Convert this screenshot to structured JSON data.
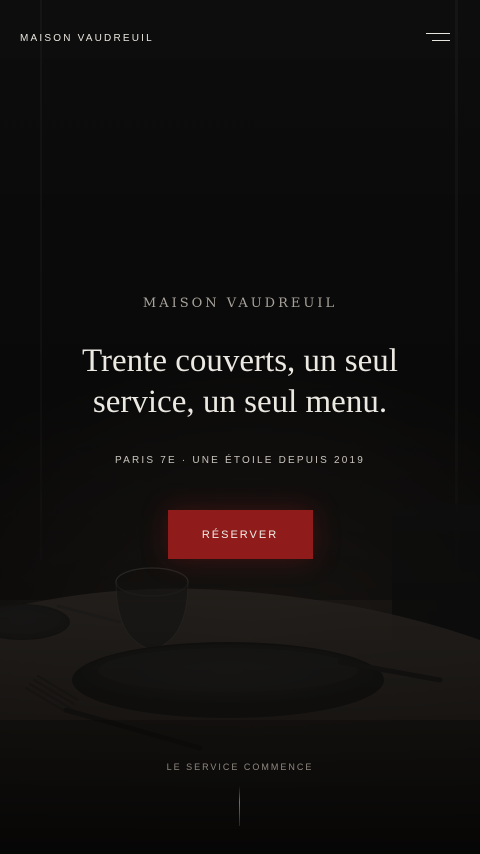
{
  "header": {
    "brand": "MAISON VAUDREUIL",
    "menu_icon": "hamburger-menu-icon"
  },
  "hero": {
    "eyebrow": "MAISON VAUDREUIL",
    "headline_line1": "Trente couverts, un seul",
    "headline_line2": "service, un seul menu.",
    "subline": "PARIS 7E · UNE ÉTOILE DEPUIS 2019",
    "cta_label": "RÉSERVER"
  },
  "scroll_cue": {
    "label": "LE SERVICE COMMENCE"
  },
  "colors": {
    "background": "#0b0b0b",
    "accent": "#8f1b1b",
    "text_light": "#ece8e2",
    "text_muted": "#a9a39b"
  }
}
